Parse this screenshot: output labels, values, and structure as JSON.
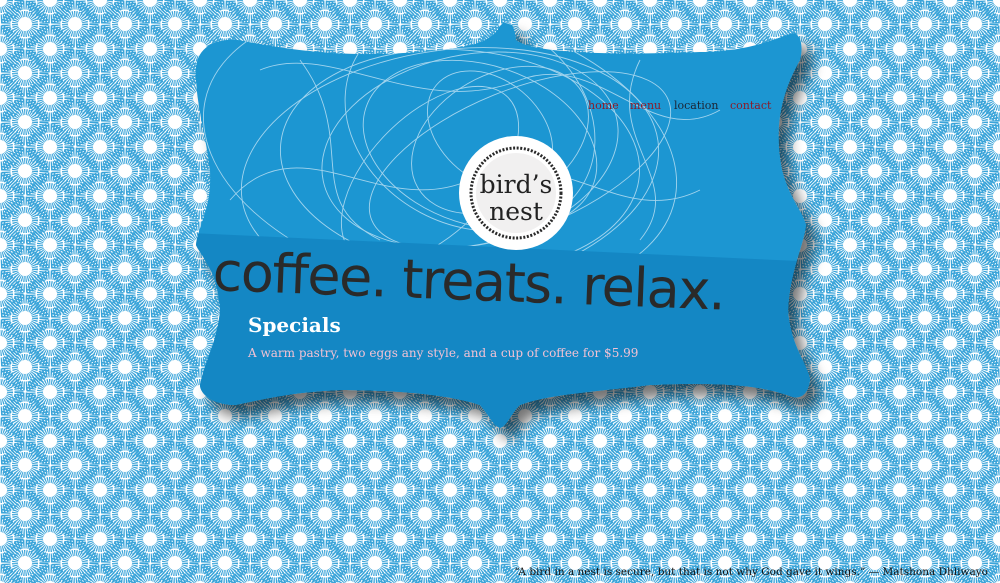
{
  "colors": {
    "frame_blue": "#1b96d2",
    "band_blue": "#1487c4",
    "pattern_blue": "#3aa4d9",
    "nav_link": "#8a1c2a",
    "nav_active": "#1c2433",
    "specials_text": "#f3c2d4"
  },
  "nav": {
    "items": [
      {
        "label": "home"
      },
      {
        "label": "menu"
      },
      {
        "label": "location"
      },
      {
        "label": "contact"
      }
    ]
  },
  "logo": {
    "line1": "bird’s",
    "line2": "nest"
  },
  "hero": {
    "tagline": "coffee. treats. relax."
  },
  "specials": {
    "title": "Specials",
    "text": "A warm pastry, two eggs any style, and a cup of coffee for $5.99"
  },
  "footer": {
    "quote": "“A bird in a nest is secure, but that is not why God gave it wings.” — Matshona Dhliwayo"
  }
}
